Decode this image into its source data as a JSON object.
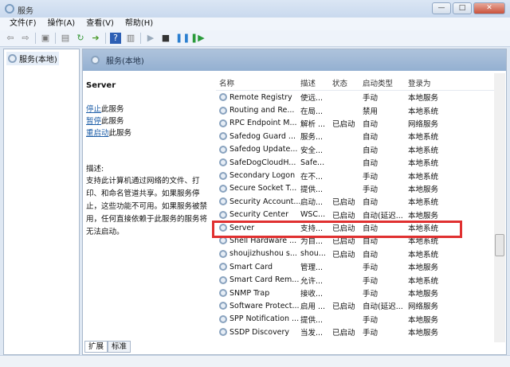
{
  "window": {
    "title": "服务",
    "min": "—",
    "max": "□",
    "close": "✕"
  },
  "menu": [
    "文件(F)",
    "操作(A)",
    "查看(V)",
    "帮助(H)"
  ],
  "tree": {
    "root": "服务(本地)"
  },
  "panel": {
    "title": "服务(本地)"
  },
  "details": {
    "name": "Server",
    "actions": [
      {
        "link": "停止",
        "rest": "此服务"
      },
      {
        "link": "暂停",
        "rest": "此服务"
      },
      {
        "link": "重启动",
        "rest": "此服务"
      }
    ],
    "desc_label": "描述:",
    "desc": "支持此计算机通过网络的文件、打印、和命名管道共享。如果服务停止，这些功能不可用。如果服务被禁用，任何直接依赖于此服务的服务将无法启动。"
  },
  "columns": [
    "名称",
    "描述",
    "状态",
    "启动类型",
    "登录为"
  ],
  "rows": [
    [
      "Remote Registry",
      "使远...",
      "",
      "手动",
      "本地服务"
    ],
    [
      "Routing and Re...",
      "在局...",
      "",
      "禁用",
      "本地系统"
    ],
    [
      "RPC Endpoint M...",
      "解析 ...",
      "已启动",
      "自动",
      "网络服务"
    ],
    [
      "Safedog Guard ...",
      "服务...",
      "",
      "自动",
      "本地系统"
    ],
    [
      "Safedog Update...",
      "安全...",
      "",
      "自动",
      "本地系统"
    ],
    [
      "SafeDogCloudH...",
      "Safe...",
      "",
      "自动",
      "本地系统"
    ],
    [
      "Secondary Logon",
      "在不...",
      "",
      "手动",
      "本地系统"
    ],
    [
      "Secure Socket T...",
      "提供...",
      "",
      "手动",
      "本地服务"
    ],
    [
      "Security Account...",
      "启动...",
      "已启动",
      "自动",
      "本地系统"
    ],
    [
      "Security Center",
      "WSC...",
      "已启动",
      "自动(延迟...",
      "本地服务"
    ],
    [
      "Server",
      "支持...",
      "已启动",
      "自动",
      "本地系统"
    ],
    [
      "Shell Hardware ...",
      "为自...",
      "已启动",
      "自动",
      "本地系统"
    ],
    [
      "shoujizhushou s...",
      "shou...",
      "已启动",
      "自动",
      "本地系统"
    ],
    [
      "Smart Card",
      "管理...",
      "",
      "手动",
      "本地服务"
    ],
    [
      "Smart Card Rem...",
      "允许...",
      "",
      "手动",
      "本地系统"
    ],
    [
      "SNMP Trap",
      "接收...",
      "",
      "手动",
      "本地服务"
    ],
    [
      "Software Protect...",
      "启用 ...",
      "已启动",
      "自动(延迟...",
      "网络服务"
    ],
    [
      "SPP Notification ...",
      "提供...",
      "",
      "手动",
      "本地服务"
    ],
    [
      "SSDP Discovery",
      "当发...",
      "已启动",
      "手动",
      "本地服务"
    ]
  ],
  "tabs": [
    "扩展",
    "标准"
  ],
  "highlight_color": "#e03030"
}
